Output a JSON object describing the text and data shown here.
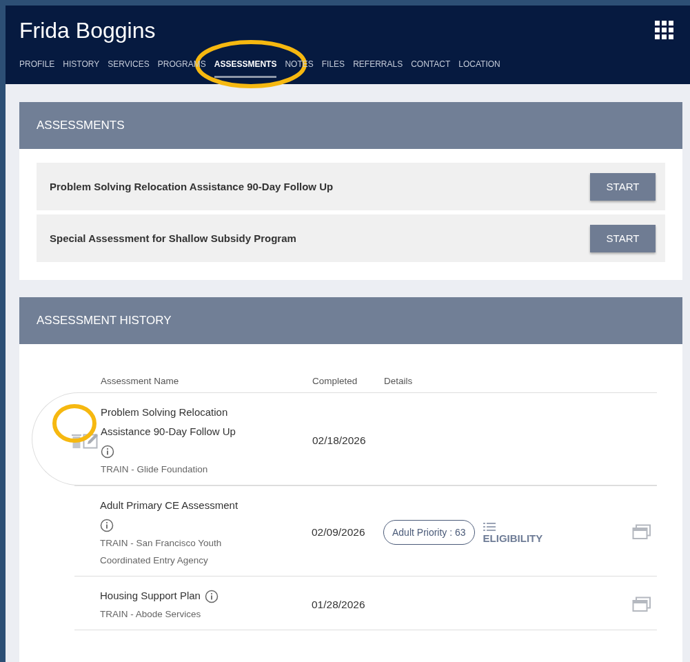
{
  "header": {
    "client_name": "Frida Boggins"
  },
  "tabs": [
    {
      "label": "PROFILE",
      "selected": false
    },
    {
      "label": "HISTORY",
      "selected": false
    },
    {
      "label": "SERVICES",
      "selected": false
    },
    {
      "label": "PROGRAMS",
      "selected": false
    },
    {
      "label": "ASSESSMENTS",
      "selected": true
    },
    {
      "label": "NOTES",
      "selected": false
    },
    {
      "label": "FILES",
      "selected": false
    },
    {
      "label": "REFERRALS",
      "selected": false
    },
    {
      "label": "CONTACT",
      "selected": false
    },
    {
      "label": "LOCATION",
      "selected": false
    }
  ],
  "assessments": {
    "title": "ASSESSMENTS",
    "items": [
      {
        "name": "Problem Solving Relocation Assistance 90-Day Follow Up",
        "button": "START"
      },
      {
        "name": "Special Assessment for Shallow Subsidy Program",
        "button": "START"
      }
    ]
  },
  "history": {
    "title": "ASSESSMENT HISTORY",
    "columns": [
      "Assessment Name",
      "Completed",
      "Details"
    ],
    "rows": [
      {
        "name": "Problem Solving Relocation Assistance 90-Day Follow Up",
        "organization": "TRAIN - Glide Foundation",
        "completed": "02/18/2026",
        "highlighted": true
      },
      {
        "name": "Adult Primary CE Assessment",
        "organization": "TRAIN - San Francisco Youth Coordinated Entry Agency",
        "completed": "02/09/2026",
        "highlighted": false,
        "badge": "Adult Priority : 63",
        "link": "ELIGIBILITY",
        "has_view": true
      },
      {
        "name": "Housing Support Plan",
        "organization": "TRAIN - Abode Services",
        "completed": "01/28/2026",
        "highlighted": false,
        "has_view": true
      }
    ]
  }
}
